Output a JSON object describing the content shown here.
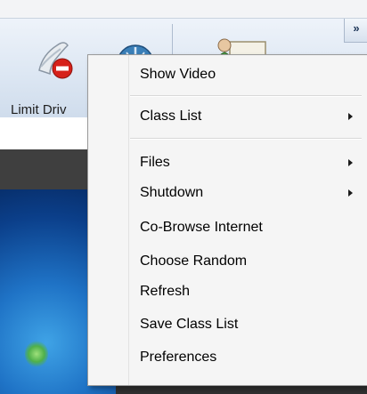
{
  "toolbar": {
    "limit_drives_label": "Limit Driv",
    "overflow_glyph": "»",
    "icons": [
      "limit-drives-icon",
      "settings-globe-icon",
      "teacher-board-icon"
    ]
  },
  "context_menu": {
    "items": [
      {
        "label": "Show Video",
        "has_submenu": false
      },
      {
        "label": "Class List",
        "has_submenu": true
      },
      {
        "label": "Files",
        "has_submenu": true
      },
      {
        "label": "Shutdown",
        "has_submenu": true
      },
      {
        "label": "Co-Browse Internet",
        "has_submenu": false
      },
      {
        "label": "Choose Random",
        "has_submenu": false
      },
      {
        "label": "Refresh",
        "has_submenu": false
      },
      {
        "label": "Save Class List",
        "has_submenu": false
      },
      {
        "label": "Preferences",
        "has_submenu": false
      }
    ]
  },
  "colors": {
    "menu_background": "#f5f5f5",
    "menu_border": "#9a9a9a",
    "toolbar_gradient_top": "#eef3fa",
    "dark_bar": "#3f3f3f",
    "desktop_blue": "#1f73c6"
  }
}
